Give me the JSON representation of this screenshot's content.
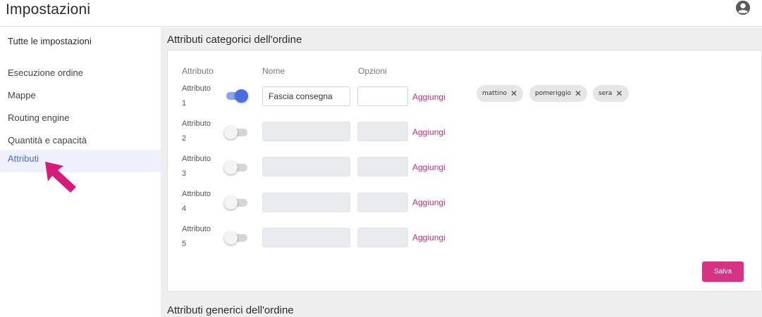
{
  "header": {
    "title": "Impostazioni",
    "account_icon": "account-circle-icon"
  },
  "sidebar": {
    "header": "Tutte le impostazioni",
    "items": [
      {
        "label": "Esecuzione ordine"
      },
      {
        "label": "Mappe"
      },
      {
        "label": "Routing engine"
      },
      {
        "label": "Quantità e capacità"
      },
      {
        "label": "Attributi",
        "active": true
      }
    ]
  },
  "main": {
    "section1_title": "Attributi categorici dell'ordine",
    "section2_title": "Attributi generici dell'ordine",
    "columns": {
      "attribute": "Attributo",
      "name": "Nome",
      "options": "Opzioni"
    },
    "rows": [
      {
        "label_word": "Attributo",
        "label_num": "1",
        "enabled": true,
        "name_value": "Fascia consegna",
        "add_label": "Aggiungi"
      },
      {
        "label_word": "Attributo",
        "label_num": "2",
        "enabled": false,
        "name_value": "",
        "add_label": "Aggiungi"
      },
      {
        "label_word": "Attributo",
        "label_num": "3",
        "enabled": false,
        "name_value": "",
        "add_label": "Aggiungi"
      },
      {
        "label_word": "Attributo",
        "label_num": "4",
        "enabled": false,
        "name_value": "",
        "add_label": "Aggiungi"
      },
      {
        "label_word": "Attributo",
        "label_num": "5",
        "enabled": false,
        "name_value": "",
        "add_label": "Aggiungi"
      }
    ],
    "chips": [
      {
        "label": "mattino"
      },
      {
        "label": "pomeriggio"
      },
      {
        "label": "sera"
      }
    ],
    "save_label": "Salva"
  },
  "colors": {
    "accent": "#d63384",
    "toggle_on": "#4a6ee0",
    "link": "#c2307a",
    "active_nav": "#eef1fd"
  }
}
